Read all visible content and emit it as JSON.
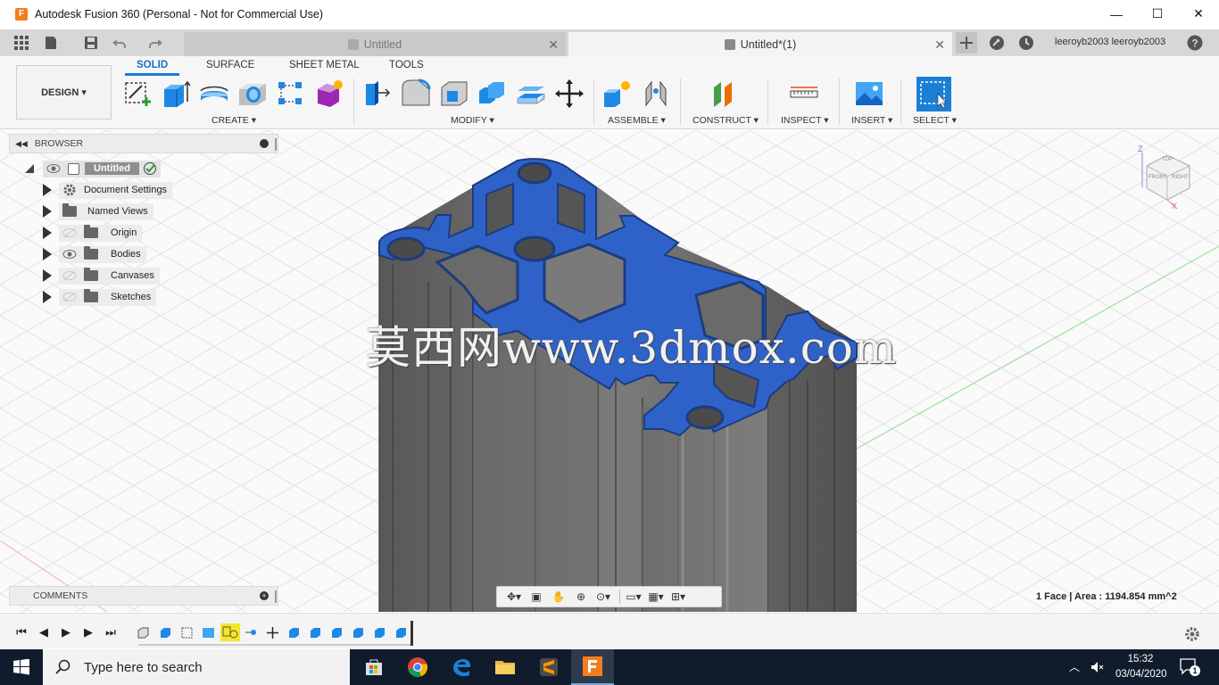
{
  "window": {
    "title": "Autodesk Fusion 360 (Personal - Not for Commercial Use)",
    "minimize": "—",
    "maximize": "☐",
    "close": "✕"
  },
  "tabs": {
    "inactive_label": "Untitled",
    "active_label": "Untitled*(1)",
    "user": "leeroyb2003 leeroyb2003",
    "help": "?"
  },
  "ribbon": {
    "workspace": "DESIGN ▾",
    "tabs": [
      "SOLID",
      "SURFACE",
      "SHEET METAL",
      "TOOLS"
    ],
    "groups": {
      "create": "CREATE ▾",
      "modify": "MODIFY ▾",
      "assemble": "ASSEMBLE ▾",
      "construct": "CONSTRUCT ▾",
      "inspect": "INSPECT ▾",
      "insert": "INSERT ▾",
      "select": "SELECT ▾"
    }
  },
  "browser": {
    "title": "BROWSER",
    "root": "Untitled",
    "items": [
      "Document Settings",
      "Named Views",
      "Origin",
      "Bodies",
      "Canvases",
      "Sketches"
    ]
  },
  "comments": {
    "title": "COMMENTS"
  },
  "viewcube": {
    "top": "TOP",
    "front": "FRONT",
    "right": "RIGHT",
    "axis_z": "Z",
    "axis_x": "X"
  },
  "status": {
    "selection": "1 Face | Area : 1194.854 mm^2"
  },
  "watermark": "莫西网www.3dmox.com",
  "taskbar": {
    "search_placeholder": "Type here to search",
    "time": "15:32",
    "date": "03/04/2020",
    "notifications": "1"
  },
  "colors": {
    "accent": "#1a7ad7",
    "face_blue": "#2f62c9",
    "taskbar": "#101c2b"
  }
}
